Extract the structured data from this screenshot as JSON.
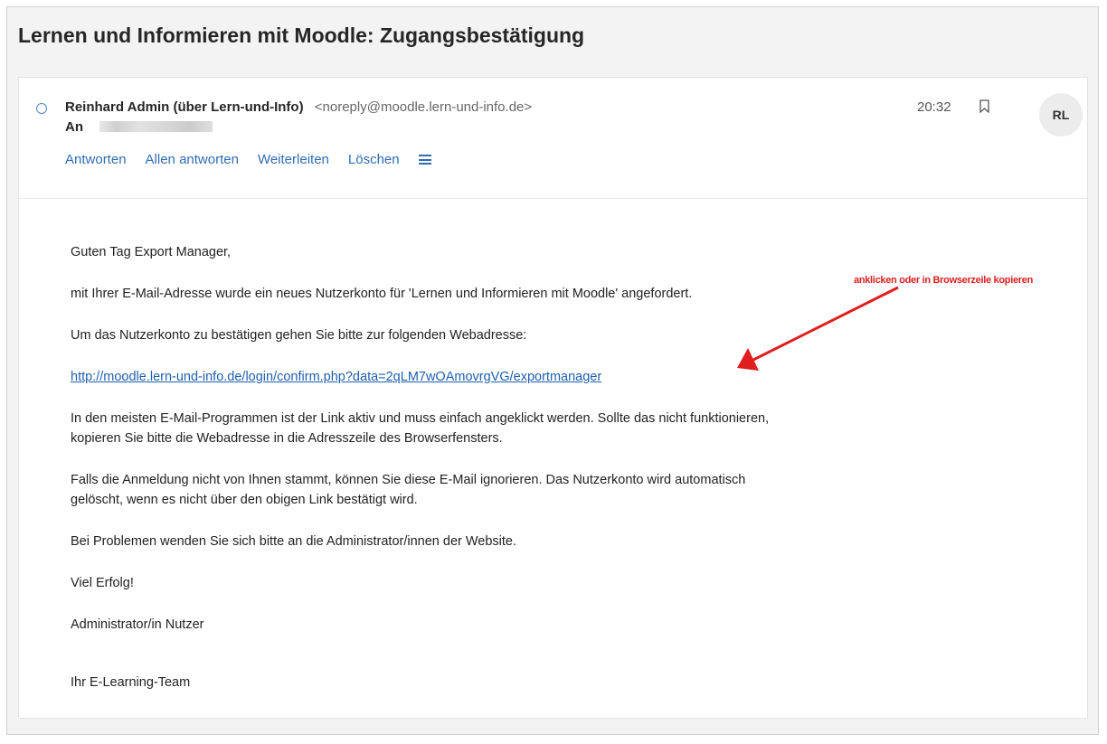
{
  "email": {
    "subject": "Lernen und Informieren mit Moodle: Zugangsbestätigung",
    "sender_name": "Reinhard Admin (über Lern-und-Info)",
    "sender_address": "<noreply@moodle.lern-und-info.de>",
    "to_label": "An",
    "time": "20:32",
    "avatar_initials": "RL",
    "actions": {
      "reply": "Antworten",
      "reply_all": "Allen antworten",
      "forward": "Weiterleiten",
      "delete": "Löschen"
    },
    "body": {
      "greeting": "Guten Tag Export Manager,",
      "p1": "mit Ihrer E-Mail-Adresse wurde ein neues Nutzerkonto für 'Lernen und Informieren mit Moodle' angefordert.",
      "p2": "Um das Nutzerkonto zu bestätigen gehen Sie bitte zur folgenden Webadresse:",
      "link": "http://moodle.lern-und-info.de/login/confirm.php?data=2qLM7wOAmovrgVG/exportmanager",
      "p3_line1": "In den meisten E-Mail-Programmen ist der Link aktiv und muss einfach angeklickt werden. Sollte das nicht funktionieren,",
      "p3_line2": "kopieren Sie bitte die Webadresse in die Adresszeile des Browserfensters.",
      "p4_line1": "Falls die Anmeldung nicht von Ihnen stammt, können Sie diese E-Mail ignorieren. Das Nutzerkonto wird automatisch",
      "p4_line2": "gelöscht, wenn es nicht über den obigen Link bestätigt wird.",
      "p5": "Bei Problemen wenden Sie sich bitte an die Administrator/innen der Website.",
      "p6": "Viel Erfolg!",
      "p7": "Administrator/in Nutzer",
      "signature": "Ihr E-Learning-Team"
    },
    "annotation": "anklicken oder in Browserzeile kopieren"
  },
  "colors": {
    "link": "#1f5fae",
    "accent": "#2f6db4",
    "annotation": "#e01e1e"
  },
  "icons": [
    "unread-circle-icon",
    "bookmark-icon",
    "more-menu-icon",
    "arrow-annotation-icon"
  ]
}
